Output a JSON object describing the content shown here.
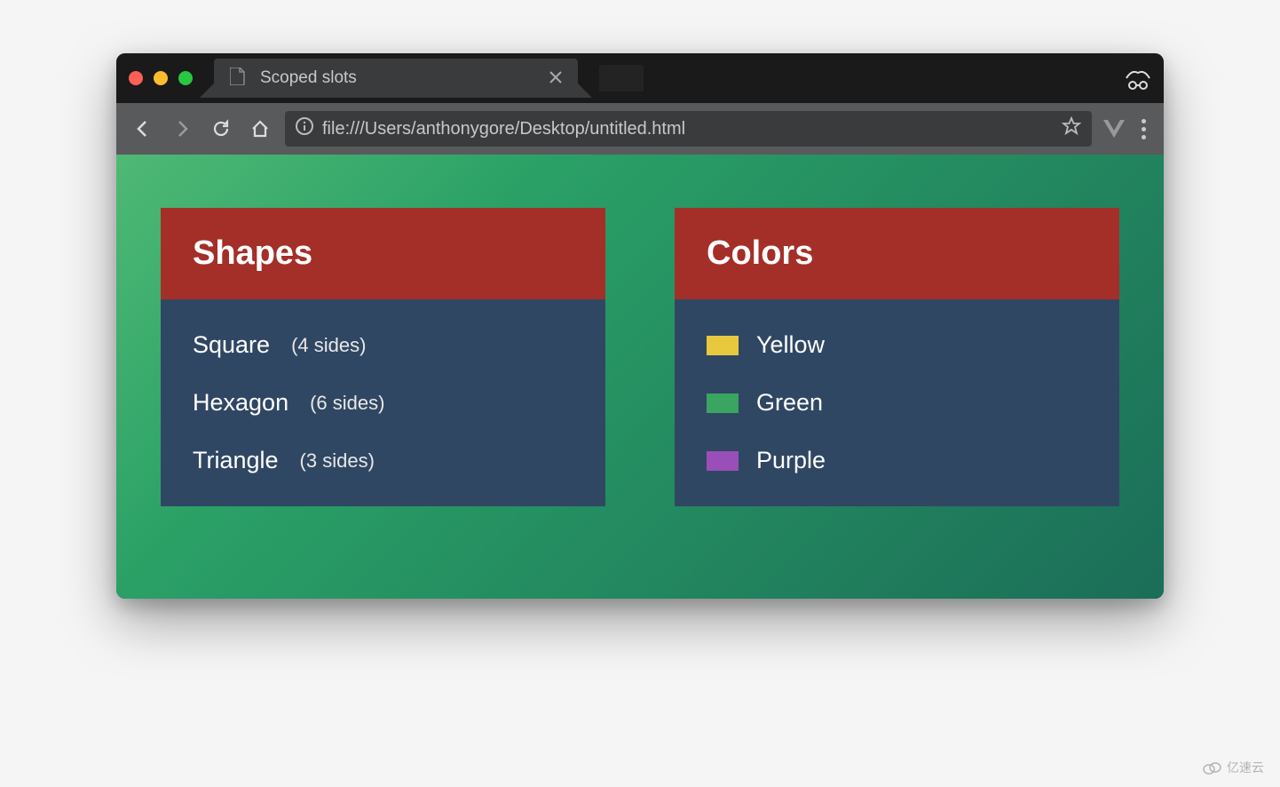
{
  "tab": {
    "title": "Scoped slots"
  },
  "toolbar": {
    "url": "file:///Users/anthonygore/Desktop/untitled.html"
  },
  "cards": {
    "shapes": {
      "title": "Shapes",
      "items": [
        {
          "name": "Square",
          "detail": "(4 sides)"
        },
        {
          "name": "Hexagon",
          "detail": "(6 sides)"
        },
        {
          "name": "Triangle",
          "detail": "(3 sides)"
        }
      ]
    },
    "colors": {
      "title": "Colors",
      "items": [
        {
          "name": "Yellow",
          "hex": "#e8c93d"
        },
        {
          "name": "Green",
          "hex": "#3aa561"
        },
        {
          "name": "Purple",
          "hex": "#9a4fb8"
        }
      ]
    }
  },
  "watermark": "亿速云"
}
